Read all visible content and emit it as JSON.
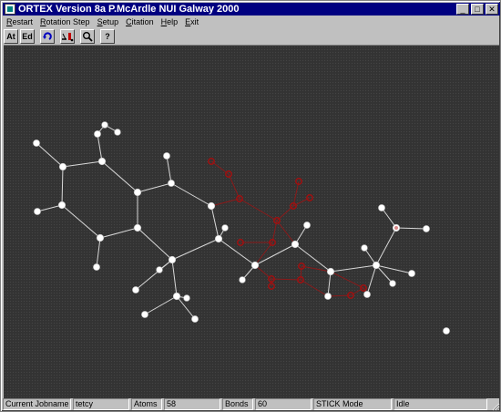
{
  "window": {
    "title": "ORTEX Version 8a P.McArdle NUI Galway 2000",
    "minimize_glyph": "_",
    "maximize_glyph": "□",
    "close_glyph": "✕"
  },
  "menu": [
    {
      "mnemonic": "R",
      "rest": "estart"
    },
    {
      "mnemonic": "R",
      "rest": "otation Step"
    },
    {
      "mnemonic": "S",
      "rest": "etup"
    },
    {
      "mnemonic": "C",
      "rest": "itation"
    },
    {
      "mnemonic": "H",
      "rest": "elp"
    },
    {
      "mnemonic": "E",
      "rest": "xit"
    }
  ],
  "toolbar": {
    "atoms_label": "At",
    "edit_label": "Ed",
    "rotate_icon": "rotate-icon",
    "bond_tool_icon": "bond-tool-icon",
    "zoom_icon": "magnifier-icon",
    "help_label": "?"
  },
  "colors": {
    "canvas_bg": "#333333",
    "atom_white": "#ffffff",
    "bond_white": "#d8d8d8",
    "atom_red": "#a01010",
    "bond_red": "#8b1a1a"
  },
  "status": {
    "jobname_label": "Current Jobname",
    "jobname_value": "tetcy",
    "atoms_label": "Atoms",
    "atoms_value": "58",
    "bonds_label": "Bonds",
    "bonds_value": "60",
    "mode": "STICK Mode",
    "state": "Idle"
  }
}
